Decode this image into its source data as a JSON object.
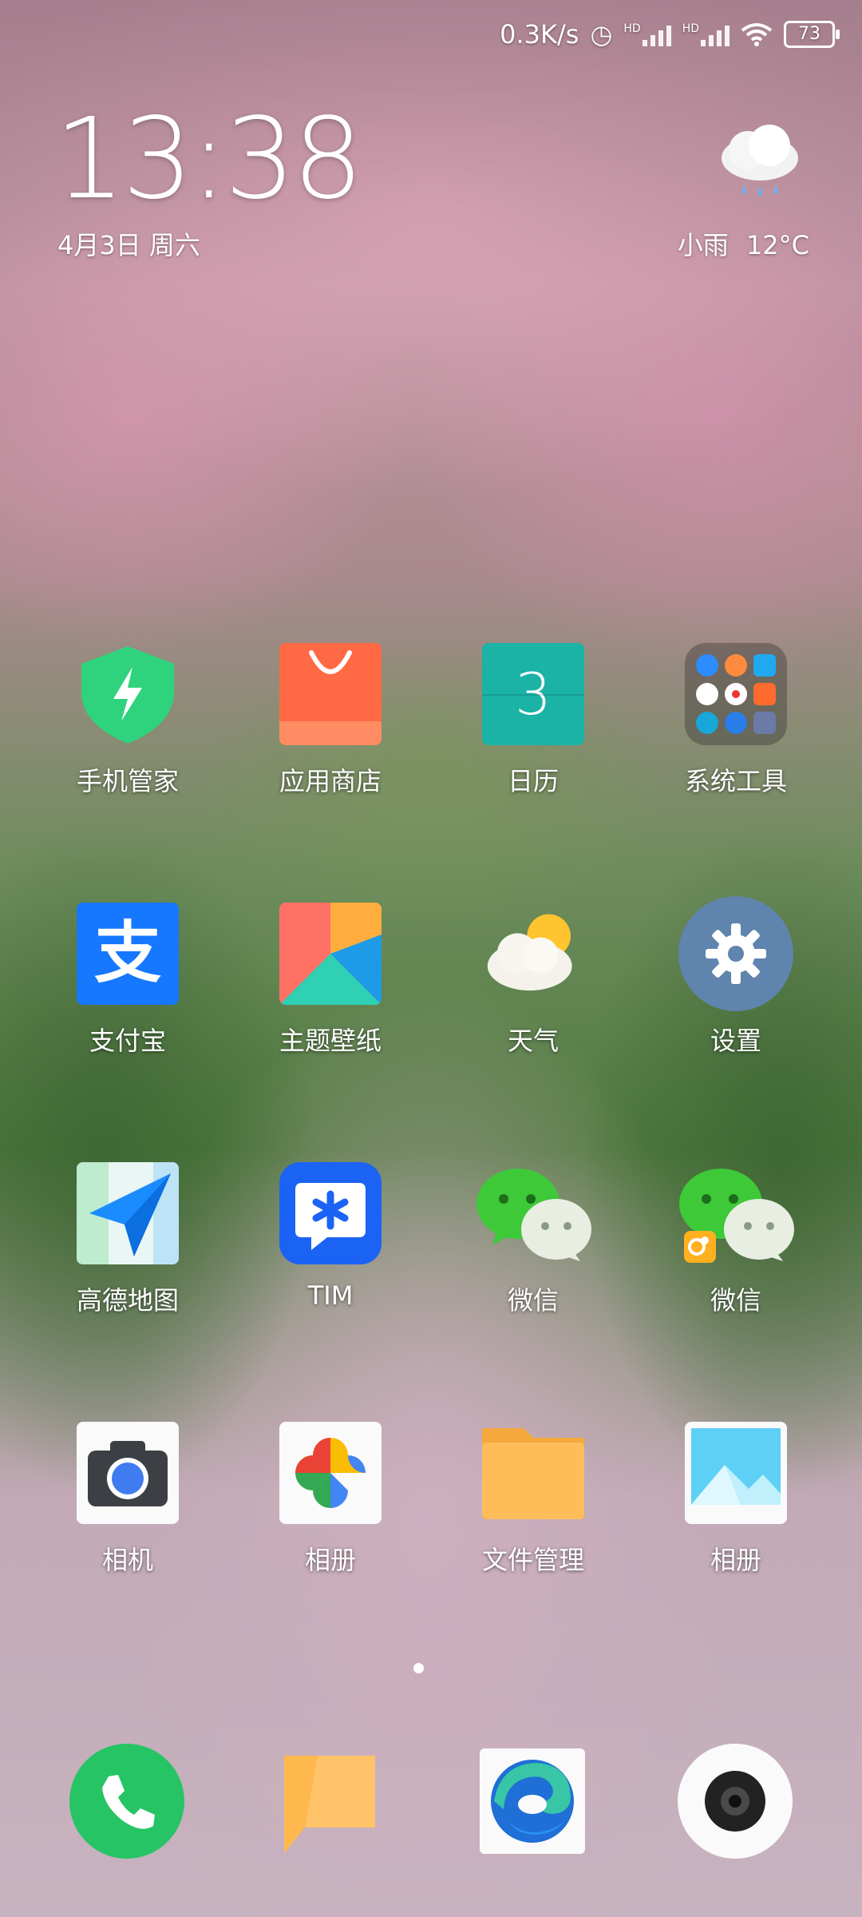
{
  "status_bar": {
    "network_speed": "0.3K/s",
    "battery_level": "73",
    "signal_badge_1": "HD",
    "signal_badge_2": "HD"
  },
  "clock": {
    "time": "13:38",
    "date": "4月3日 周六"
  },
  "weather": {
    "condition": "小雨",
    "temperature": "12°C",
    "icon": "cloud-rain-icon"
  },
  "calendar_icon_day": "3",
  "apps": [
    {
      "label": "手机管家",
      "icon": "security-shield-icon"
    },
    {
      "label": "应用商店",
      "icon": "app-store-bag-icon"
    },
    {
      "label": "日历",
      "icon": "calendar-icon"
    },
    {
      "label": "系统工具",
      "icon": "folder-icon"
    },
    {
      "label": "支付宝",
      "icon": "alipay-icon"
    },
    {
      "label": "主题壁纸",
      "icon": "themes-icon"
    },
    {
      "label": "天气",
      "icon": "weather-icon"
    },
    {
      "label": "设置",
      "icon": "gear-icon"
    },
    {
      "label": "高德地图",
      "icon": "map-navigation-icon"
    },
    {
      "label": "TIM",
      "icon": "tim-icon"
    },
    {
      "label": "微信",
      "icon": "wechat-icon"
    },
    {
      "label": "微信",
      "icon": "wechat-dual-icon"
    },
    {
      "label": "相机",
      "icon": "camera-icon"
    },
    {
      "label": "相册",
      "icon": "google-photos-icon"
    },
    {
      "label": "文件管理",
      "icon": "file-folder-icon"
    },
    {
      "label": "相册",
      "icon": "gallery-icon"
    }
  ],
  "page_indicator": {
    "current": 1,
    "total": 1
  },
  "dock": [
    {
      "icon": "phone-icon"
    },
    {
      "icon": "messages-icon"
    },
    {
      "icon": "edge-browser-icon"
    },
    {
      "icon": "camera-lens-icon"
    }
  ],
  "colors": {
    "security_green": "#2fd27d",
    "store_orange": "#ff6a45",
    "calendar_teal": "#1ab3a6",
    "alipay_blue": "#1677ff",
    "settings_slate": "#5f84ad",
    "tim_blue": "#1b63f5",
    "wechat_green": "#3ec939",
    "folder_yellow": "#ffbd5a",
    "phone_green": "#27c466"
  }
}
